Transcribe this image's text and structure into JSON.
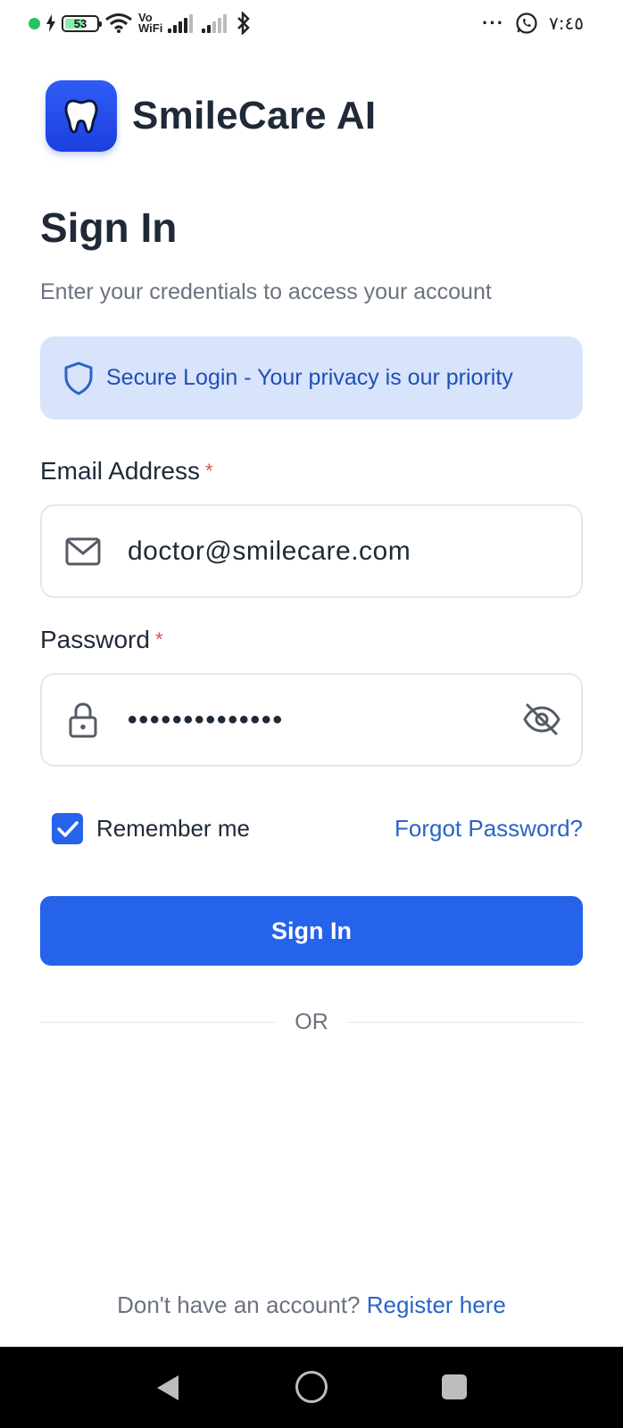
{
  "status_bar": {
    "battery_level": "53",
    "network_label_top": "Vo",
    "network_label_bottom": "WiFi",
    "overflow": "···",
    "time": "٧:٤٥"
  },
  "brand": {
    "name": "SmileCare AI",
    "logo_icon": "tooth-icon"
  },
  "page": {
    "title": "Sign In",
    "subtitle": "Enter your credentials to access your account"
  },
  "secure_banner": {
    "icon": "shield-icon",
    "text": "Secure Login - Your privacy is our priority"
  },
  "email": {
    "label": "Email Address",
    "required_mark": "*",
    "value": "doctor@smilecare.com",
    "icon": "mail-icon"
  },
  "password": {
    "label": "Password",
    "required_mark": "*",
    "masked_value": "••••••••••••••",
    "icon": "lock-icon",
    "toggle_icon": "eye-off-icon"
  },
  "remember": {
    "label": "Remember me",
    "checked": true
  },
  "forgot_label": "Forgot Password?",
  "signin_button_label": "Sign In",
  "divider_label": "OR",
  "register": {
    "prompt": "Don't have an account?",
    "link": "Register here"
  },
  "colors": {
    "primary": "#2563eb",
    "link": "#2b63c9",
    "banner_bg": "#d8e4fb",
    "banner_text": "#1e4fb8",
    "required": "#e05252"
  }
}
